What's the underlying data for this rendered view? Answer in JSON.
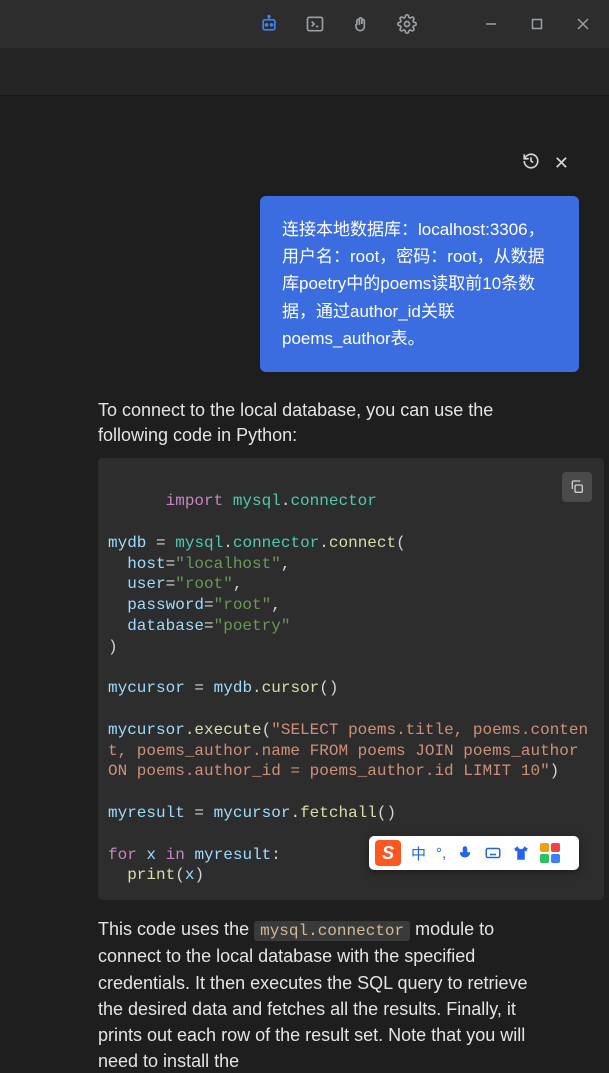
{
  "user_message": "连接本地数据库：localhost:3306，用户名：root，密码：root，从数据库poetry中的poems读取前10条数据，通过author_id关联poems_author表。",
  "assistant_intro": "To connect to the local database, you can use the following code in Python:",
  "code": {
    "l1_import": "import",
    "l1_mod": "mysql",
    "l1_sub": "connector",
    "l2_a": "mydb",
    "l2_b": "mysql",
    "l2_c": "connector",
    "l2_d": "connect",
    "host_k": "host",
    "host_v": "\"localhost\"",
    "user_k": "user",
    "user_v": "\"root\"",
    "pwd_k": "password",
    "pwd_v": "\"root\"",
    "db_k": "database",
    "db_v": "\"poetry\"",
    "cur_a": "mycursor",
    "cur_b": "mydb",
    "cur_c": "cursor",
    "exe_a": "mycursor",
    "exe_b": "execute",
    "sql": "\"SELECT poems.title, poems.content, poems_author.name FROM poems JOIN poems_author ON poems.author_id = poems_author.id LIMIT 10\"",
    "res_a": "myresult",
    "res_b": "mycursor",
    "res_c": "fetchall",
    "for_kw": "for",
    "for_x": "x",
    "in_kw": "in",
    "for_it": "myresult",
    "print_fn": "print",
    "print_arg": "x"
  },
  "inline_module": "mysql.connector",
  "assistant_outro_before": "This code uses the ",
  "assistant_outro_after": " module to connect to the local database with the specified credentials. It then executes the SQL query to retrieve the desired data and fetches all the results. Finally, it prints out each row of the result set. Note that you will need to install the",
  "ime": {
    "logo": "S",
    "lang": "中"
  }
}
